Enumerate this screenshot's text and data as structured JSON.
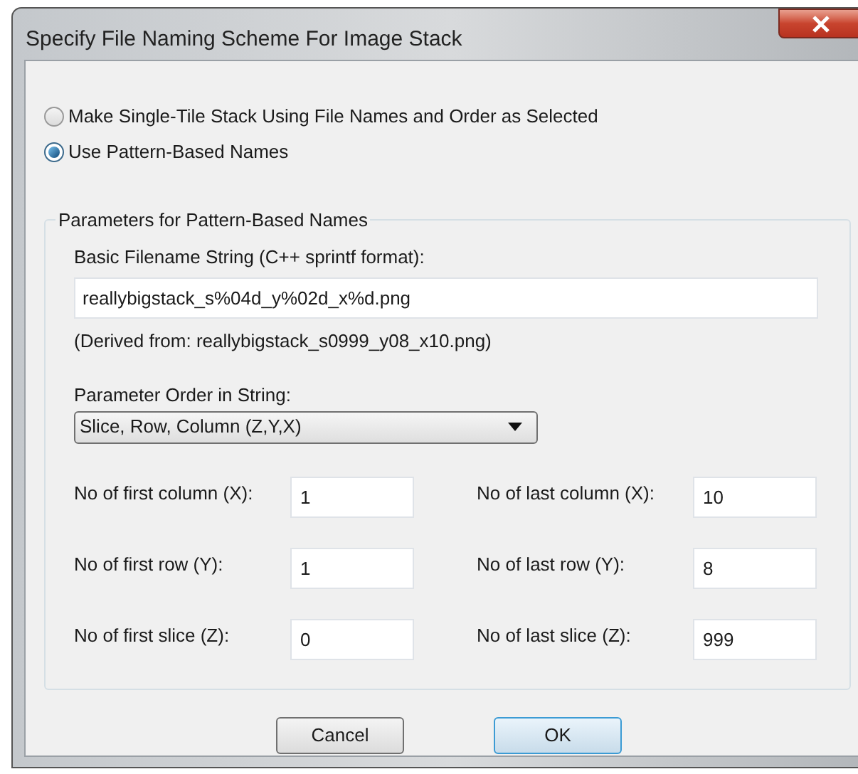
{
  "window": {
    "title": "Specify File Naming Scheme For Image Stack"
  },
  "mode_options": [
    {
      "label": "Make Single-Tile Stack Using File Names and Order as Selected",
      "selected": false
    },
    {
      "label": "Use Pattern-Based Names",
      "selected": true
    }
  ],
  "parameters": {
    "legend": "Parameters for Pattern-Based Names",
    "filename_label": "Basic Filename String (C++ sprintf format):",
    "filename_value": "reallybigstack_s%04d_y%02d_x%d.png",
    "derived_note": "(Derived from: reallybigstack_s0999_y08_x10.png)",
    "order_label": "Parameter Order in String:",
    "order_value": "Slice, Row, Column (Z,Y,X)",
    "ranges": [
      {
        "label": "No of first column (X):",
        "value": "1"
      },
      {
        "label": "No of last column (X):",
        "value": "10"
      },
      {
        "label": "No of first row (Y):",
        "value": "1"
      },
      {
        "label": "No of last row (Y):",
        "value": "8"
      },
      {
        "label": "No of first slice (Z):",
        "value": "0"
      },
      {
        "label": "No of last slice (Z):",
        "value": "999"
      }
    ]
  },
  "buttons": [
    {
      "label": "Cancel",
      "default": false
    },
    {
      "label": "OK",
      "default": true
    }
  ]
}
